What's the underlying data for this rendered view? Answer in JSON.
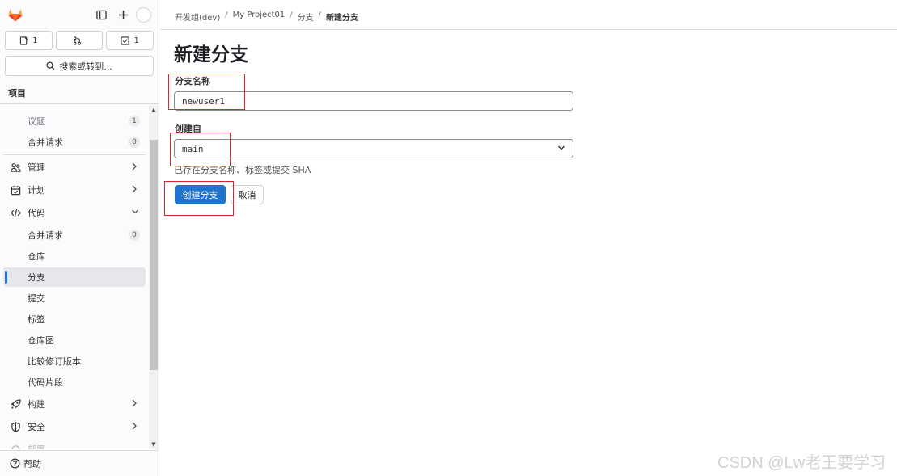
{
  "sidebar": {
    "counters": [
      {
        "icon": "issues-icon",
        "count": "1"
      },
      {
        "icon": "merge-request-icon",
        "count": ""
      },
      {
        "icon": "todo-icon",
        "count": "1"
      }
    ],
    "search_label": "搜索或转到...",
    "section_label": "项目",
    "items": [
      {
        "label": "议题",
        "badge": "1"
      },
      {
        "label": "合并请求",
        "badge": "0"
      },
      {
        "label": "管理"
      },
      {
        "label": "计划"
      },
      {
        "label": "代码"
      },
      {
        "label": "合并请求",
        "badge": "0"
      },
      {
        "label": "仓库"
      },
      {
        "label": "分支"
      },
      {
        "label": "提交"
      },
      {
        "label": "标签"
      },
      {
        "label": "仓库图"
      },
      {
        "label": "比较修订版本"
      },
      {
        "label": "代码片段"
      },
      {
        "label": "构建"
      },
      {
        "label": "安全"
      },
      {
        "label": "部署"
      }
    ],
    "help_label": "帮助"
  },
  "breadcrumb": [
    "开发组(dev)",
    "My Project01",
    "分支",
    "新建分支"
  ],
  "page": {
    "title": "新建分支",
    "branch_name_label": "分支名称",
    "branch_name_value": "newuser1",
    "create_from_label": "创建自",
    "create_from_value": "main",
    "create_from_help": "已存在分支名称、标签或提交 SHA",
    "create_button": "创建分支",
    "cancel_button": "取消"
  },
  "colors": {
    "primary": "#1f75cb",
    "annotation": "#e5212b"
  },
  "watermark": "CSDN @Lw老王要学习"
}
